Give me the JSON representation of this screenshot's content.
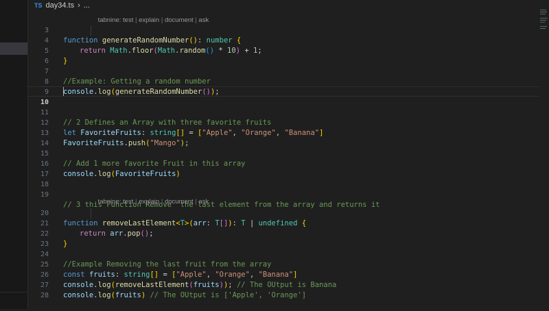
{
  "breadcrumb": {
    "lang_badge": "TS",
    "file": "day34.ts",
    "rest": "..."
  },
  "codelens": {
    "prefix": "tabnine:",
    "items": [
      "test",
      "explain",
      "document",
      "ask"
    ]
  },
  "editor": {
    "active_line": 10,
    "lines": [
      {
        "n": "3",
        "text": "function generateRandomNumber(): number {"
      },
      {
        "n": "4",
        "text": "return Math.floor(Math.random() * 10) + 1;"
      },
      {
        "n": "5",
        "text": "}"
      },
      {
        "n": "6",
        "text": ""
      },
      {
        "n": "7",
        "text": "//Example: Getting a random number"
      },
      {
        "n": "8",
        "text": "console.log(generateRandomNumber());"
      },
      {
        "n": "9",
        "text": ""
      },
      {
        "n": "10",
        "text": ""
      },
      {
        "n": "11",
        "text": "// 2 Defines an Array with three favorite fruits"
      },
      {
        "n": "12",
        "text": "let FavoriteFruits: string[] = [\"Apple\", \"Orange\", \"Banana\"]"
      },
      {
        "n": "13",
        "text": "FavoriteFruits.push(\"Mango\");"
      },
      {
        "n": "14",
        "text": ""
      },
      {
        "n": "15",
        "text": "// Add 1 more favorite Fruit in this array"
      },
      {
        "n": "16",
        "text": "console.log(FavoriteFruits)"
      },
      {
        "n": "17",
        "text": ""
      },
      {
        "n": "18",
        "text": ""
      },
      {
        "n": "19",
        "text": "// 3 this Function Remove  the last element from the array and returns it"
      },
      {
        "n": "20",
        "text": "function removeLastElement<T>(arr: T[]): T | undefined {"
      },
      {
        "n": "21",
        "text": "return arr.pop();"
      },
      {
        "n": "22",
        "text": "}"
      },
      {
        "n": "23",
        "text": ""
      },
      {
        "n": "24",
        "text": "//Example Removing the last fruit from the array"
      },
      {
        "n": "25",
        "text": "const fruits: string[] = [\"Apple\", \"Orange\", \"Banana\"]"
      },
      {
        "n": "26",
        "text": "console.log(removeLastElement(fruits)); // The OUtput is Banana"
      },
      {
        "n": "27",
        "text": "console.log(fruits) // The OUtput is ['Apple', 'Orange']"
      },
      {
        "n": "28",
        "text": ""
      }
    ]
  },
  "token_colors": {
    "keyword": "#569cd6",
    "control": "#c586c0",
    "function": "#dcdcaa",
    "variable": "#9cdcfe",
    "type": "#4ec9b0",
    "string": "#ce9178",
    "number": "#b5cea8",
    "comment": "#6a9955",
    "background": "#1f1f1f"
  }
}
